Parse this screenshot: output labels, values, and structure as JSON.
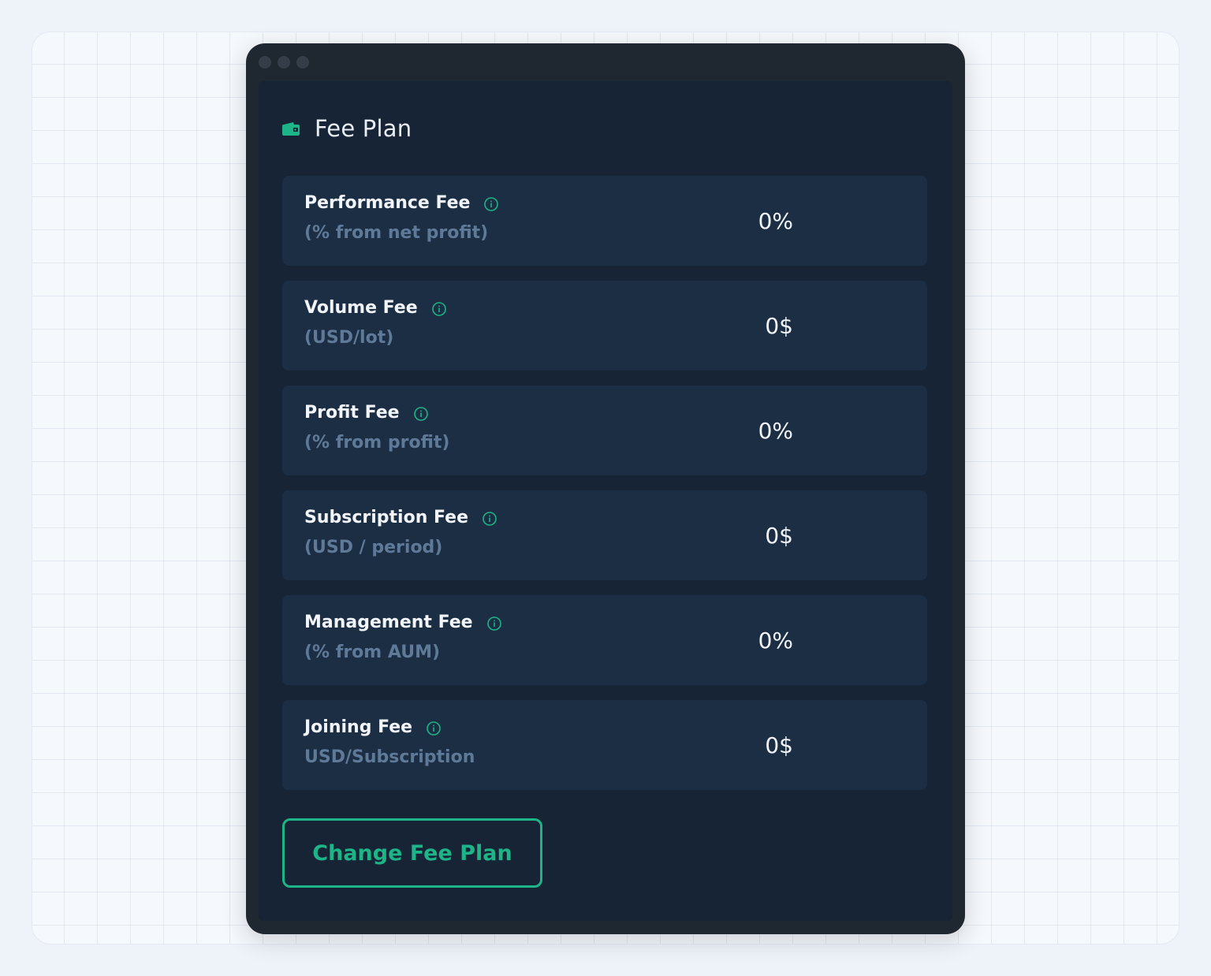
{
  "panel": {
    "title": "Fee Plan",
    "icon": "wallet-icon"
  },
  "fees": [
    {
      "label": "Performance Fee",
      "sub": "(% from net profit)",
      "value": "0%",
      "icon": "info-icon"
    },
    {
      "label": "Volume Fee",
      "sub": "(USD/lot)",
      "value": "0$",
      "icon": "info-icon"
    },
    {
      "label": "Profit Fee",
      "sub": "(% from profit)",
      "value": "0%",
      "icon": "info-icon"
    },
    {
      "label": "Subscription Fee",
      "sub": "(USD / period)",
      "value": "0$",
      "icon": "info-icon"
    },
    {
      "label": "Management Fee",
      "sub": "(% from AUM)",
      "value": "0%",
      "icon": "info-icon"
    },
    {
      "label": "Joining Fee",
      "sub": "USD/Subscription",
      "value": "0$",
      "icon": "info-icon"
    }
  ],
  "actions": {
    "change_label": "Change Fee Plan"
  },
  "colors": {
    "accent": "#1db487",
    "panel_bg": "#162436",
    "row_bg": "#1c2e44",
    "muted_text": "#5f7a98",
    "window_frame": "#1f2730"
  }
}
